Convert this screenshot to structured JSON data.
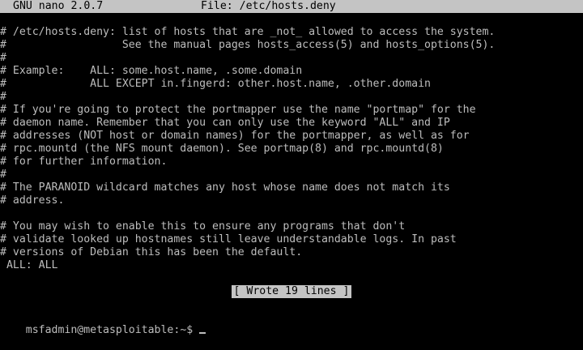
{
  "titlebar": {
    "app_name": "GNU nano 2.0.7",
    "file_label": "File: /etc/hosts.deny"
  },
  "editor": {
    "lines": [
      "# /etc/hosts.deny: list of hosts that are _not_ allowed to access the system.",
      "#                  See the manual pages hosts_access(5) and hosts_options(5).",
      "#",
      "# Example:    ALL: some.host.name, .some.domain",
      "#             ALL EXCEPT in.fingerd: other.host.name, .other.domain",
      "#",
      "# If you're going to protect the portmapper use the name \"portmap\" for the",
      "# daemon name. Remember that you can only use the keyword \"ALL\" and IP",
      "# addresses (NOT host or domain names) for the portmapper, as well as for",
      "# rpc.mountd (the NFS mount daemon). See portmap(8) and rpc.mountd(8)",
      "# for further information.",
      "#",
      "# The PARANOID wildcard matches any host whose name does not match its",
      "# address.",
      "",
      "# You may wish to enable this to ensure any programs that don't",
      "# validate looked up hostnames still leave understandable logs. In past",
      "# versions of Debian this has been the default.",
      " ALL: ALL"
    ]
  },
  "status": {
    "message": "[ Wrote 19 lines ]"
  },
  "shell": {
    "prompt": "msfadmin@metasploitable:~$ "
  }
}
